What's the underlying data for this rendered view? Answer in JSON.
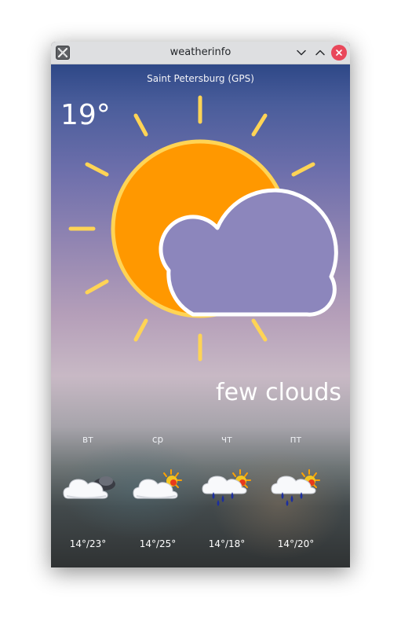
{
  "window": {
    "title": "weatherinfo",
    "app_icon": "app-x-icon",
    "buttons": [
      "chevron-down-icon",
      "chevron-up-icon",
      "close-icon"
    ]
  },
  "location": "Saint Petersburg (GPS)",
  "current": {
    "temperature": "19°",
    "condition": "few clouds",
    "icon": "sun-behind-cloud-icon"
  },
  "forecast": [
    {
      "day": "вт",
      "range": "14°/23°",
      "icon": "cloud-night-icon"
    },
    {
      "day": "ср",
      "range": "14°/25°",
      "icon": "cloud-sun-icon"
    },
    {
      "day": "чт",
      "range": "14°/18°",
      "icon": "rain-sun-icon"
    },
    {
      "day": "пт",
      "range": "14°/20°",
      "icon": "rain-sun-icon"
    }
  ],
  "colors": {
    "sun": "#ff9800",
    "sun_rays": "#ffd455",
    "cloud_outline": "#ffffff",
    "close_button": "#e9475a"
  }
}
